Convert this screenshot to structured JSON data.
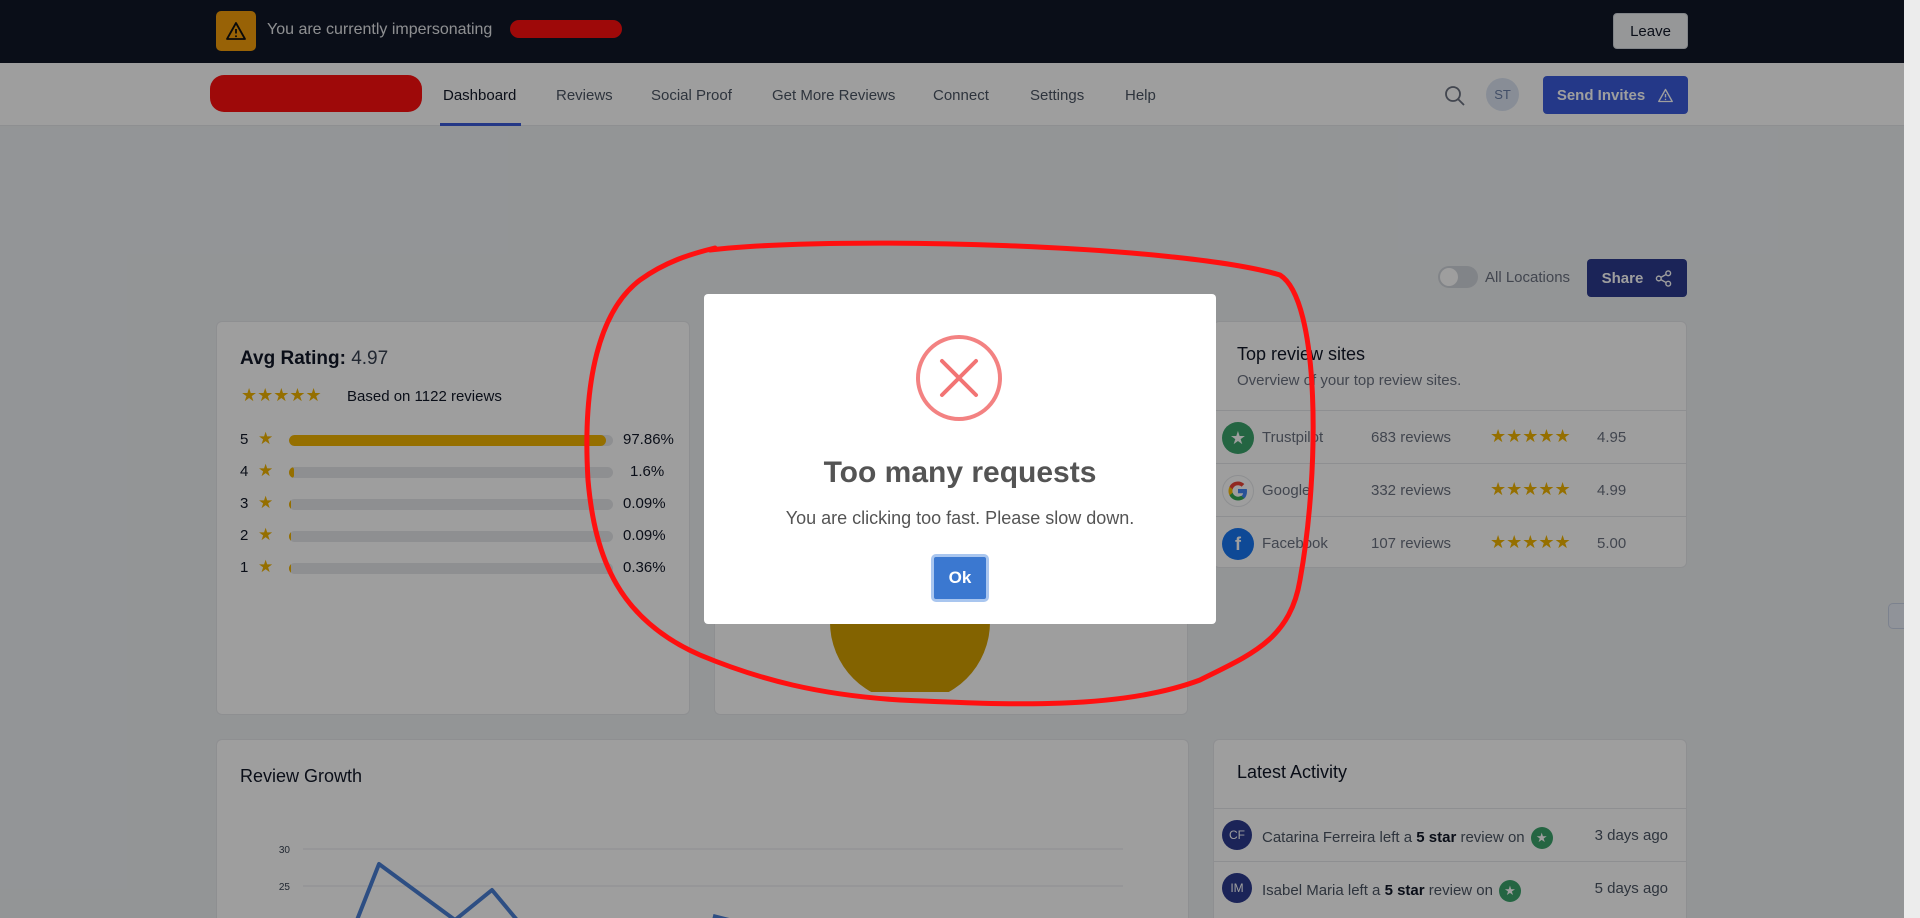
{
  "impersonation": {
    "text": "You are currently impersonating",
    "leave_label": "Leave"
  },
  "nav": {
    "items": [
      "Dashboard",
      "Reviews",
      "Social Proof",
      "Get More Reviews",
      "Connect",
      "Settings",
      "Help"
    ],
    "active": "Dashboard",
    "avatar_initials": "ST",
    "send_invites_label": "Send Invites"
  },
  "toolbar": {
    "toggle_label": "All Locations",
    "toggle_on": false,
    "share_label": "Share"
  },
  "avg_rating": {
    "label": "Avg Rating:",
    "value": "4.97",
    "stars": "★★★★★",
    "based_on": "Based on 1122 reviews",
    "breakdown": [
      {
        "stars": "5",
        "percent": "97.86%",
        "fill": 97.86
      },
      {
        "stars": "4",
        "percent": "1.6%",
        "fill": 1.6
      },
      {
        "stars": "3",
        "percent": "0.09%",
        "fill": 0.09
      },
      {
        "stars": "2",
        "percent": "0.09%",
        "fill": 0.09
      },
      {
        "stars": "1",
        "percent": "0.36%",
        "fill": 0.36
      }
    ]
  },
  "review_sites": {
    "title": "Top review sites",
    "subtitle": "Overview of your top review sites.",
    "sites": [
      {
        "name": "Trustpilot",
        "count": "683 reviews",
        "stars": "★★★★★",
        "score": "4.95",
        "icon": "trustpilot-icon",
        "color": "#3aa36b"
      },
      {
        "name": "Google",
        "count": "332 reviews",
        "stars": "★★★★★",
        "score": "4.99",
        "icon": "google-icon",
        "color": "#ffffff"
      },
      {
        "name": "Facebook",
        "count": "107 reviews",
        "stars": "★★★★★",
        "score": "5.00",
        "icon": "facebook-icon",
        "color": "#1877f2"
      }
    ]
  },
  "review_growth": {
    "title": "Review Growth",
    "y_ticks": [
      "30",
      "25"
    ]
  },
  "latest_activity": {
    "title": "Latest Activity",
    "items": [
      {
        "initials": "CF",
        "name": "Catarina Ferreira",
        "prefix": "left a",
        "rating": "5 star",
        "suffix": "review on",
        "time": "3 days ago"
      },
      {
        "initials": "IM",
        "name": "Isabel Maria",
        "prefix": "left a",
        "rating": "5 star",
        "suffix": "review on",
        "time": "5 days ago"
      }
    ]
  },
  "modal": {
    "title": "Too many requests",
    "message": "You are clicking too fast. Please slow down.",
    "ok_label": "Ok",
    "icon": "error-x-icon"
  },
  "colors": {
    "accent": "#3b5bdb",
    "star": "#f1b400",
    "annotation": "#ff1010"
  }
}
